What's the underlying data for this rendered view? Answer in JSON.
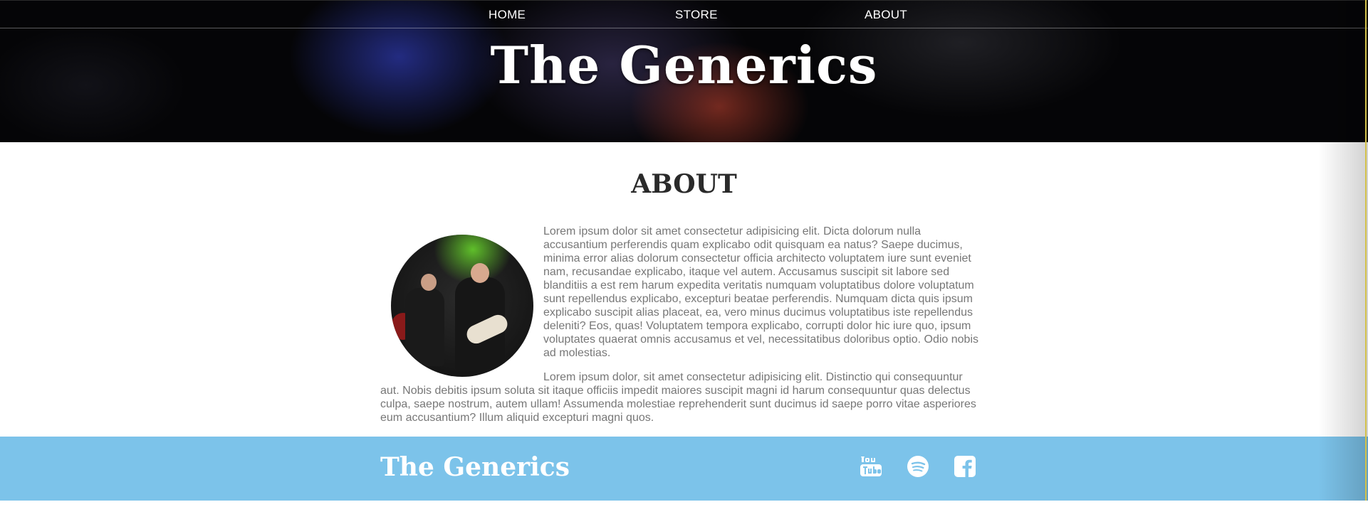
{
  "nav": {
    "items": [
      {
        "label": "HOME"
      },
      {
        "label": "STORE"
      },
      {
        "label": "ABOUT"
      }
    ]
  },
  "header": {
    "title": "The Generics"
  },
  "about": {
    "heading": "ABOUT",
    "paragraphs": [
      "Lorem ipsum dolor sit amet consectetur adipisicing elit. Dicta dolorum nulla accusantium perferendis quam explicabo odit quisquam ea natus? Saepe ducimus, minima error alias dolorum consectetur officia architecto voluptatem iure sunt eveniet nam, recusandae explicabo, itaque vel autem. Accusamus suscipit sit labore sed blanditiis a est rem harum expedita veritatis numquam voluptatibus dolore voluptatum sunt repellendus explicabo, excepturi beatae perferendis. Numquam dicta quis ipsum explicabo suscipit alias placeat, ea, vero minus ducimus voluptatibus iste repellendus deleniti? Eos, quas! Voluptatem tempora explicabo, corrupti dolor hic iure quo, ipsum voluptates quaerat omnis accusamus et vel, necessitatibus doloribus optio. Odio nobis ad molestias.",
      "Lorem ipsum dolor, sit amet consectetur adipisicing elit. Distinctio qui consequuntur aut. Nobis debitis ipsum soluta sit itaque officiis impedit maiores suscipit magni id harum consequuntur quas delectus culpa, saepe nostrum, autem ullam! Assumenda molestiae reprehenderit sunt ducimus id saepe porro vitae asperiores eum accusantium? Illum aliquid excepturi magni quos."
    ]
  },
  "footer": {
    "title": "The Generics",
    "social": [
      {
        "icon": "youtube-icon"
      },
      {
        "icon": "spotify-icon"
      },
      {
        "icon": "facebook-icon"
      }
    ]
  },
  "colors": {
    "footer_bg": "#7cc3ea",
    "body_text": "#777777",
    "heading": "#2a2a2a"
  }
}
